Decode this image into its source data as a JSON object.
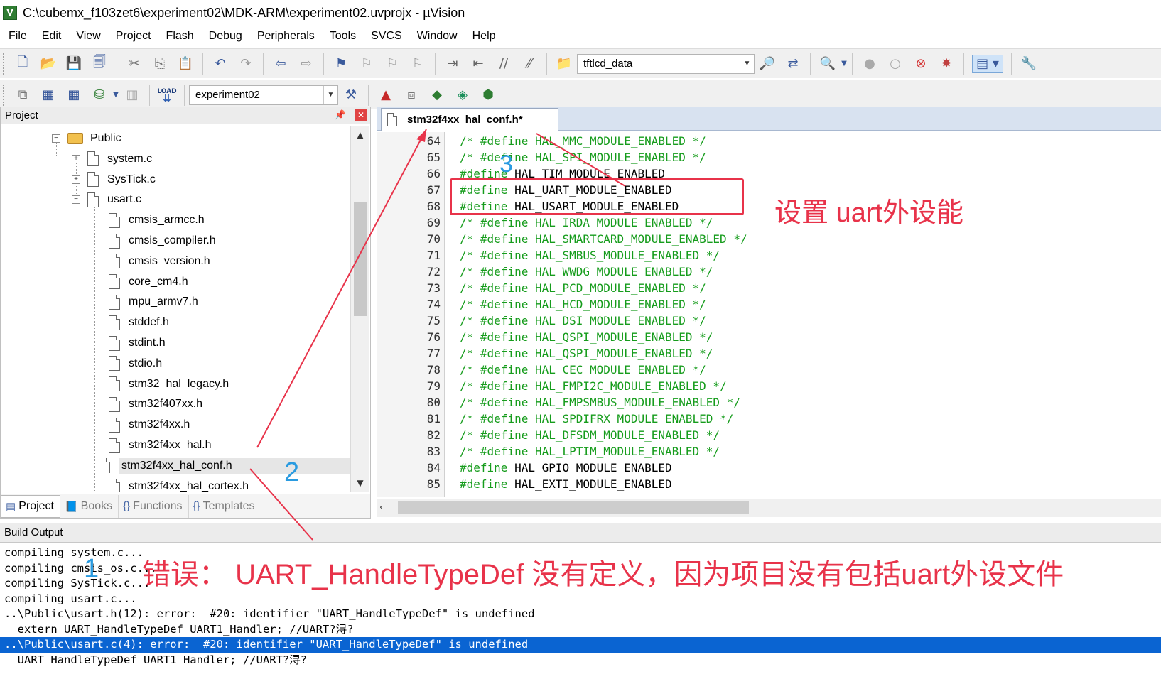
{
  "window": {
    "title": "C:\\cubemx_f103zet6\\experiment02\\MDK-ARM\\experiment02.uvprojx - µVision",
    "app_icon_label": "V"
  },
  "menu": [
    "File",
    "Edit",
    "View",
    "Project",
    "Flash",
    "Debug",
    "Peripherals",
    "Tools",
    "SVCS",
    "Window",
    "Help"
  ],
  "toolbar1": {
    "find_combo_value": "tftlcd_data",
    "icons": [
      "new-file-icon",
      "open-file-icon",
      "save-icon",
      "save-all-icon",
      "cut-icon",
      "copy-icon",
      "paste-icon",
      "undo-icon",
      "redo-icon",
      "navigate-back-icon",
      "navigate-forward-icon",
      "bookmark-icon",
      "prev-bookmark-icon",
      "next-bookmark-icon",
      "clear-bookmarks-icon",
      "indent-icon",
      "unindent-icon",
      "comment-icon",
      "uncomment-icon",
      "find-in-files-icon",
      "incremental-find-icon",
      "debug-session-icon",
      "breakpoint-icon",
      "disable-breakpoint-icon",
      "kill-breakpoints-icon",
      "clear-breakpoints-icon",
      "window-layout-icon",
      "configure-icon"
    ]
  },
  "toolbar2": {
    "target_combo_value": "experiment02",
    "load_label": "LOAD"
  },
  "project_panel": {
    "title": "Project",
    "tree": [
      {
        "label": "Public",
        "type": "folder",
        "expander": "−"
      },
      {
        "label": "system.c",
        "type": "file",
        "expander": "+"
      },
      {
        "label": "SysTick.c",
        "type": "file",
        "expander": "+"
      },
      {
        "label": "usart.c",
        "type": "file",
        "expander": "−"
      },
      {
        "label": "cmsis_armcc.h",
        "type": "header"
      },
      {
        "label": "cmsis_compiler.h",
        "type": "header"
      },
      {
        "label": "cmsis_version.h",
        "type": "header"
      },
      {
        "label": "core_cm4.h",
        "type": "header"
      },
      {
        "label": "mpu_armv7.h",
        "type": "header"
      },
      {
        "label": "stddef.h",
        "type": "header"
      },
      {
        "label": "stdint.h",
        "type": "header"
      },
      {
        "label": "stdio.h",
        "type": "header"
      },
      {
        "label": "stm32_hal_legacy.h",
        "type": "header"
      },
      {
        "label": "stm32f407xx.h",
        "type": "header"
      },
      {
        "label": "stm32f4xx.h",
        "type": "header"
      },
      {
        "label": "stm32f4xx_hal.h",
        "type": "header"
      },
      {
        "label": "stm32f4xx_hal_conf.h",
        "type": "header",
        "selected": true
      },
      {
        "label": "stm32f4xx_hal_cortex.h",
        "type": "header"
      }
    ],
    "tabs": [
      {
        "label": "Project",
        "active": true
      },
      {
        "label": "Books",
        "active": false
      },
      {
        "label": "Functions",
        "active": false
      },
      {
        "label": "Templates",
        "active": false
      }
    ]
  },
  "editor": {
    "tab_label": "stm32f4xx_hal_conf.h*",
    "lines": [
      {
        "n": "64",
        "text": "/* #define HAL_MMC_MODULE_ENABLED */",
        "kind": "comment"
      },
      {
        "n": "65",
        "text": "/* #define HAL_SPI_MODULE_ENABLED */",
        "kind": "comment"
      },
      {
        "n": "66",
        "text": "#define HAL_TIM_MODULE_ENABLED",
        "kind": "define"
      },
      {
        "n": "67",
        "text": "#define HAL_UART_MODULE_ENABLED",
        "kind": "define"
      },
      {
        "n": "68",
        "text": "#define HAL_USART_MODULE_ENABLED",
        "kind": "define"
      },
      {
        "n": "69",
        "text": "/* #define HAL_IRDA_MODULE_ENABLED */",
        "kind": "comment"
      },
      {
        "n": "70",
        "text": "/* #define HAL_SMARTCARD_MODULE_ENABLED */",
        "kind": "comment"
      },
      {
        "n": "71",
        "text": "/* #define HAL_SMBUS_MODULE_ENABLED */",
        "kind": "comment"
      },
      {
        "n": "72",
        "text": "/* #define HAL_WWDG_MODULE_ENABLED */",
        "kind": "comment"
      },
      {
        "n": "73",
        "text": "/* #define HAL_PCD_MODULE_ENABLED */",
        "kind": "comment"
      },
      {
        "n": "74",
        "text": "/* #define HAL_HCD_MODULE_ENABLED */",
        "kind": "comment"
      },
      {
        "n": "75",
        "text": "/* #define HAL_DSI_MODULE_ENABLED */",
        "kind": "comment"
      },
      {
        "n": "76",
        "text": "/* #define HAL_QSPI_MODULE_ENABLED */",
        "kind": "comment"
      },
      {
        "n": "77",
        "text": "/* #define HAL_QSPI_MODULE_ENABLED */",
        "kind": "comment"
      },
      {
        "n": "78",
        "text": "/* #define HAL_CEC_MODULE_ENABLED */",
        "kind": "comment"
      },
      {
        "n": "79",
        "text": "/* #define HAL_FMPI2C_MODULE_ENABLED */",
        "kind": "comment"
      },
      {
        "n": "80",
        "text": "/* #define HAL_FMPSMBUS_MODULE_ENABLED */",
        "kind": "comment"
      },
      {
        "n": "81",
        "text": "/* #define HAL_SPDIFRX_MODULE_ENABLED */",
        "kind": "comment"
      },
      {
        "n": "82",
        "text": "/* #define HAL_DFSDM_MODULE_ENABLED */",
        "kind": "comment"
      },
      {
        "n": "83",
        "text": "/* #define HAL_LPTIM_MODULE_ENABLED */",
        "kind": "comment"
      },
      {
        "n": "84",
        "text": "#define HAL_GPIO_MODULE_ENABLED",
        "kind": "define"
      },
      {
        "n": "85",
        "text": "#define HAL_EXTI_MODULE_ENABLED",
        "kind": "define"
      }
    ]
  },
  "build_output": {
    "title": "Build Output",
    "lines": [
      {
        "text": "compiling system.c...",
        "selected": false
      },
      {
        "text": "compiling cmsis_os.c...",
        "selected": false
      },
      {
        "text": "compiling SysTick.c...",
        "selected": false
      },
      {
        "text": "compiling usart.c...",
        "selected": false
      },
      {
        "text": "..\\Public\\usart.h(12): error:  #20: identifier \"UART_HandleTypeDef\" is undefined",
        "selected": false
      },
      {
        "text": "  extern UART_HandleTypeDef UART1_Handler; //UART?浔?",
        "selected": false
      },
      {
        "text": "..\\Public\\usart.c(4): error:  #20: identifier \"UART_HandleTypeDef\" is undefined",
        "selected": true
      },
      {
        "text": "  UART_HandleTypeDef UART1_Handler; //UART?浔?",
        "selected": false
      }
    ]
  },
  "annotations": {
    "marker_1": "1",
    "marker_2": "2",
    "marker_3": "3",
    "box_note": "设置  uart外设能",
    "error_note": "错误：  UART_HandleTypeDef 没有定义，因为项目没有包括uart外设文件",
    "marker_color": "#2a9be0",
    "note_color": "#e8334a"
  }
}
